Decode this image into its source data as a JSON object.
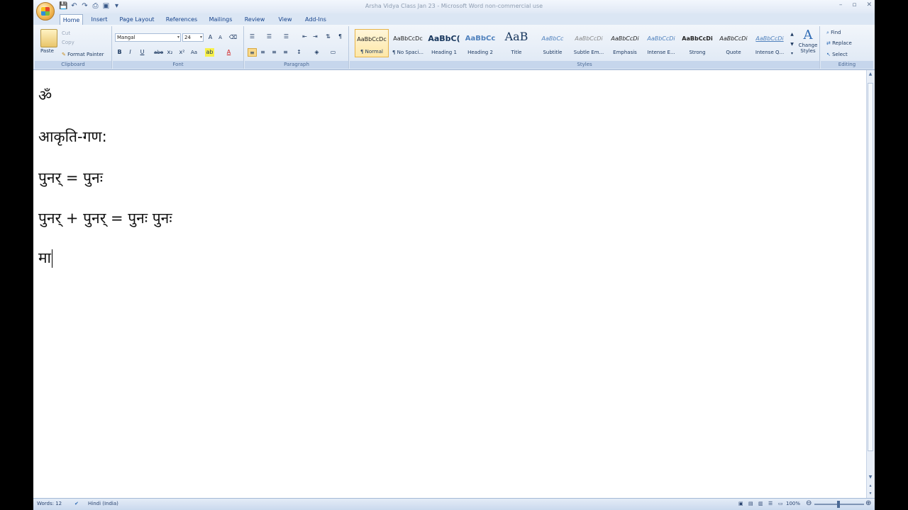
{
  "window": {
    "title": "Arsha Vidya Class Jan 23 - Microsoft Word non-commercial use",
    "controls": [
      "–",
      "▫",
      "✕"
    ]
  },
  "qat": [
    "💾",
    "↶",
    "↷",
    "⎙",
    "▣",
    "▾"
  ],
  "tabs": [
    "Home",
    "Insert",
    "Page Layout",
    "References",
    "Mailings",
    "Review",
    "View",
    "Add-Ins"
  ],
  "ribbon": {
    "clipboard": {
      "paste": "Paste",
      "cut": "Cut",
      "copy": "Copy",
      "format_painter": "Format Painter",
      "label": "Clipboard"
    },
    "font": {
      "name": "Mangal",
      "size": "24",
      "label": "Font",
      "buttons": [
        "B",
        "I",
        "U",
        "abe",
        "x₂",
        "x²",
        "Aa"
      ]
    },
    "paragraph": {
      "label": "Paragraph"
    },
    "styles": {
      "label": "Styles",
      "items": [
        {
          "sample": "AaBbCcDc",
          "name": "¶ Normal"
        },
        {
          "sample": "AaBbCcDc",
          "name": "¶ No Spaci..."
        },
        {
          "sample": "AaBbC(",
          "name": "Heading 1"
        },
        {
          "sample": "AaBbCc",
          "name": "Heading 2"
        },
        {
          "sample": "AaB",
          "name": "Title"
        },
        {
          "sample": "AaBbCc",
          "name": "Subtitle"
        },
        {
          "sample": "AaBbCcDi",
          "name": "Subtle Em..."
        },
        {
          "sample": "AaBbCcDi",
          "name": "Emphasis"
        },
        {
          "sample": "AaBbCcDi",
          "name": "Intense E..."
        },
        {
          "sample": "AaBbCcDi",
          "name": "Strong"
        },
        {
          "sample": "AaBbCcDi",
          "name": "Quote"
        },
        {
          "sample": "AaBbCcDi",
          "name": "Intense Q..."
        }
      ],
      "change_styles": "Change Styles"
    },
    "editing": {
      "label": "Editing",
      "find": "Find",
      "replace": "Replace",
      "select": "Select"
    }
  },
  "document": {
    "paragraphs": [
      "ॐ",
      "आकृति-गण:",
      "पुनर्  =  पुनः",
      "पुनर्  +  पुनर्  =  पुनः  पुनः",
      "मा"
    ]
  },
  "statusbar": {
    "words": "Words: 12",
    "language": "Hindi (India)",
    "zoom": "100%"
  }
}
